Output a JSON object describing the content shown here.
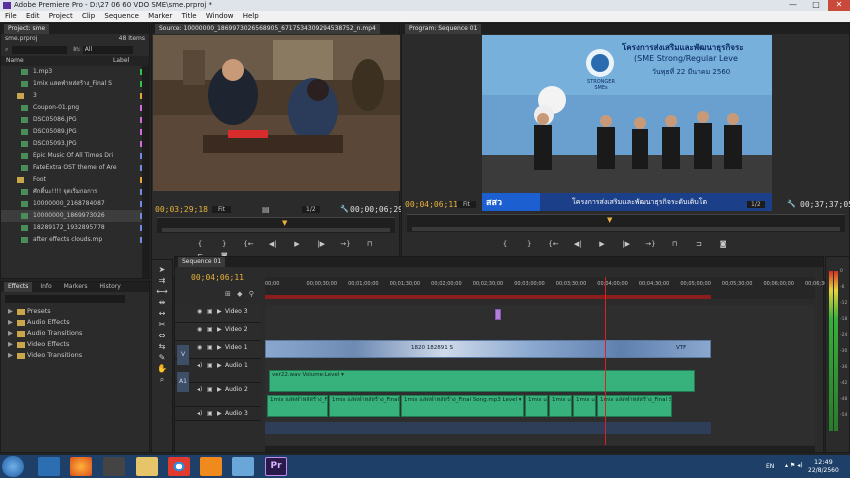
{
  "window": {
    "title": "Adobe Premiere Pro - D:\\27 06 60 VDO SME\\sme.prproj *",
    "minimize": "—",
    "maximize": "□",
    "close": "✕"
  },
  "menu": [
    "File",
    "Edit",
    "Project",
    "Clip",
    "Sequence",
    "Marker",
    "Title",
    "Window",
    "Help"
  ],
  "project": {
    "tab": "Project: sme",
    "file": "sme.prproj",
    "count": "48 Items",
    "in_label": "In:",
    "in_value": "All",
    "col_name": "Name",
    "col_label": "Label",
    "items": [
      {
        "name": "1.mp3",
        "color": "#31c24a"
      },
      {
        "name": "1mix แสดพำหส่สร้าง_Final S",
        "color": "#31c24a"
      },
      {
        "name": "3",
        "color": "#e7a935"
      },
      {
        "name": "Coupon-01.png",
        "color": "#d66be0"
      },
      {
        "name": "DSC05086.JPG",
        "color": "#d66be0"
      },
      {
        "name": "DSC05089.JPG",
        "color": "#d66be0"
      },
      {
        "name": "DSC05093.JPG",
        "color": "#d66be0"
      },
      {
        "name": "Epic Music Of All Times Dri",
        "color": "#6b8ce0"
      },
      {
        "name": "FateExtra OST theme of Are",
        "color": "#6b8ce0"
      },
      {
        "name": "Foot",
        "color": "#e7a935"
      },
      {
        "name": "ศักดิ์นะ!!!! จุดเริ่มกอการ",
        "color": "#6b8ce0"
      },
      {
        "name": "10000000_2168784087",
        "color": "#6b8ce0"
      },
      {
        "name": "10000000_1869973026",
        "color": "#6b8ce0"
      },
      {
        "name": "18289172_1932895778",
        "color": "#6b8ce0"
      },
      {
        "name": "after effects clouds.mp",
        "color": "#6b8ce0"
      }
    ]
  },
  "effects": {
    "tabs": [
      "Effects",
      "Info",
      "Markers",
      "History"
    ],
    "folders": [
      "Presets",
      "Audio Effects",
      "Audio Transitions",
      "Video Effects",
      "Video Transitions"
    ]
  },
  "source": {
    "tab": "Source: 10000000_1869973026568905_6717534309294538752_n.mp4",
    "timecode": "00;03;29;18",
    "fit": "Fit",
    "scale": "1/2",
    "duration": "00;00;06;29"
  },
  "program": {
    "tab": "Program: Sequence 01",
    "timecode": "00;04;06;11",
    "fit": "Fit",
    "scale": "1/2",
    "duration": "00;37;37;05",
    "banner_line1": "โครงการส่งเสริมและพัฒนาธุรกิจระ",
    "banner_line2": "(SME Strong/Regular Leve",
    "banner_line3": "วันพุธที่ 22 มีนาคม 2560",
    "logo_text": "STRONGER SMEs",
    "ticker_left": "สสว",
    "ticker_text": "โครงการส่งเสริมและพัฒนาธุรกิจระดับเติบโต"
  },
  "timeline": {
    "tab": "Sequence 01",
    "timecode": "00;04;06;11",
    "ruler": [
      "00;00",
      "00;00;30;00",
      "00;01;00;00",
      "00;01;30;00",
      "00;02;00;00",
      "00;02;30;00",
      "00;03;00;00",
      "00;03;30;00",
      "00;04;00;00",
      "00;04;30;00",
      "00;05;00;00",
      "00;05;30;00",
      "00;06;00;00",
      "00;06;30"
    ],
    "tracks": [
      {
        "name": "Video 3",
        "kind": "video"
      },
      {
        "name": "Video 2",
        "kind": "video"
      },
      {
        "name": "Video 1",
        "kind": "video"
      },
      {
        "name": "Audio 1",
        "kind": "audio"
      },
      {
        "name": "Audio 2",
        "kind": "audio"
      },
      {
        "name": "Audio 3",
        "kind": "audio"
      }
    ],
    "v_label": "V",
    "a_label": "A1",
    "a1_clip": "ver22.wav  Volume:Level ▾",
    "a2_clips": [
      "1mix แสดพำหส่สร้าง_Final Sc",
      "1mix แสดพำหส่สร้าง_Final So",
      "1mix แสดพำหส่สร้าง_Final Song.mp3 Level ▾",
      "1mix ua",
      "1mix ua",
      "1mix ua",
      "1mix แสดพำหส่สร้าง_Final Sc"
    ],
    "v1_text": "1820 182891 S",
    "v1_text2": "VTF",
    "meter_labels": [
      "0",
      "-6",
      "-12",
      "-18",
      "-24",
      "-30",
      "-36",
      "-42",
      "-48",
      "-54"
    ]
  },
  "taskbar": {
    "lang": "EN",
    "time": "12:49",
    "date": "22/8/2560",
    "pr_label": "Pr"
  },
  "colors": {
    "accent_timecode": "#e8b23a",
    "audio_clip": "#38b27c",
    "video_clip": "#8aa8cf",
    "playhead": "#e02020"
  }
}
